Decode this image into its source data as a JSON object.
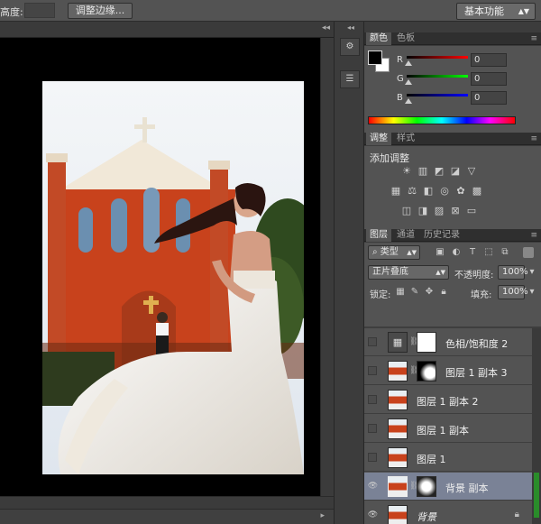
{
  "options_bar": {
    "height_label": "高度:",
    "refine_edge_button": "调整边缘...",
    "workspace_selector": "基本功能"
  },
  "color_panel": {
    "tabs": [
      "颜色",
      "色板"
    ],
    "channels": [
      {
        "label": "R",
        "value": "0"
      },
      {
        "label": "G",
        "value": "0"
      },
      {
        "label": "B",
        "value": "0"
      }
    ],
    "colors": {
      "foreground": "#000000",
      "background": "#ffffff"
    }
  },
  "adjustments_panel": {
    "tabs": [
      "调整",
      "样式"
    ],
    "title": "添加调整",
    "row1_icons": [
      "brightness-icon",
      "levels-icon",
      "curves-icon",
      "exposure-icon",
      "vibrance-icon"
    ],
    "row2_icons": [
      "hue-saturation-icon",
      "color-balance-icon",
      "black-white-icon",
      "photo-filter-icon",
      "channel-mixer-icon",
      "color-lookup-icon"
    ],
    "row3_icons": [
      "invert-icon",
      "posterize-icon",
      "threshold-icon",
      "selective-color-icon",
      "gradient-map-icon"
    ]
  },
  "layers_panel": {
    "tabs": [
      "图层",
      "通道",
      "历史记录"
    ],
    "filter_kind": "类型",
    "blend_mode": "正片叠底",
    "opacity_label": "不透明度:",
    "opacity_value": "100%",
    "lock_label": "锁定:",
    "fill_label": "填充:",
    "fill_value": "100%",
    "layers": [
      {
        "name": "色相/饱和度 2",
        "visible": false,
        "type": "adjustment",
        "has_mask": true,
        "selected": false
      },
      {
        "name": "图层 1 副本 3",
        "visible": false,
        "type": "pixel",
        "has_mask": true,
        "selected": false
      },
      {
        "name": "图层 1 副本 2",
        "visible": false,
        "type": "pixel",
        "has_mask": false,
        "selected": false
      },
      {
        "name": "图层 1 副本",
        "visible": false,
        "type": "pixel",
        "has_mask": false,
        "selected": false
      },
      {
        "name": "图层 1",
        "visible": false,
        "type": "pixel",
        "has_mask": false,
        "selected": false
      },
      {
        "name": "背景 副本",
        "visible": true,
        "type": "pixel",
        "has_mask": true,
        "selected": true
      },
      {
        "name": "背景",
        "visible": true,
        "type": "background",
        "has_mask": false,
        "selected": false,
        "locked": true
      }
    ],
    "footer_icons": [
      "link-layers-icon",
      "fx-icon",
      "add-mask-icon",
      "new-adjustment-icon",
      "new-group-icon",
      "new-layer-icon",
      "delete-layer-icon"
    ]
  }
}
